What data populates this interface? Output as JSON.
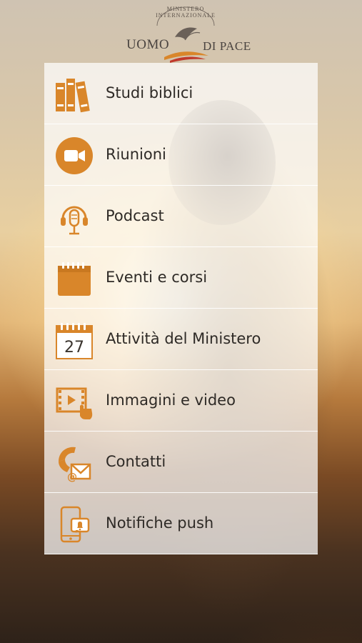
{
  "logo": {
    "arc_text": "MINISTERO INTERNAZIONALE",
    "left_text": "UOMO",
    "right_text": "DI PACE"
  },
  "menu": [
    {
      "label": "Studi biblici",
      "icon": "books-icon"
    },
    {
      "label": "Riunioni",
      "icon": "video-camera-icon"
    },
    {
      "label": "Podcast",
      "icon": "headset-microphone-icon"
    },
    {
      "label": "Eventi e corsi",
      "icon": "calendar-icon"
    },
    {
      "label": "Attività del Ministero",
      "icon": "calendar-day-icon",
      "badge": "27"
    },
    {
      "label": "Immagini e video",
      "icon": "media-tap-icon"
    },
    {
      "label": "Contatti",
      "icon": "phone-email-icon"
    },
    {
      "label": "Notifiche push",
      "icon": "phone-bell-icon"
    }
  ],
  "colors": {
    "accent": "#d9862a",
    "logo_text": "#4a4440",
    "label_text": "#2e2a26"
  }
}
